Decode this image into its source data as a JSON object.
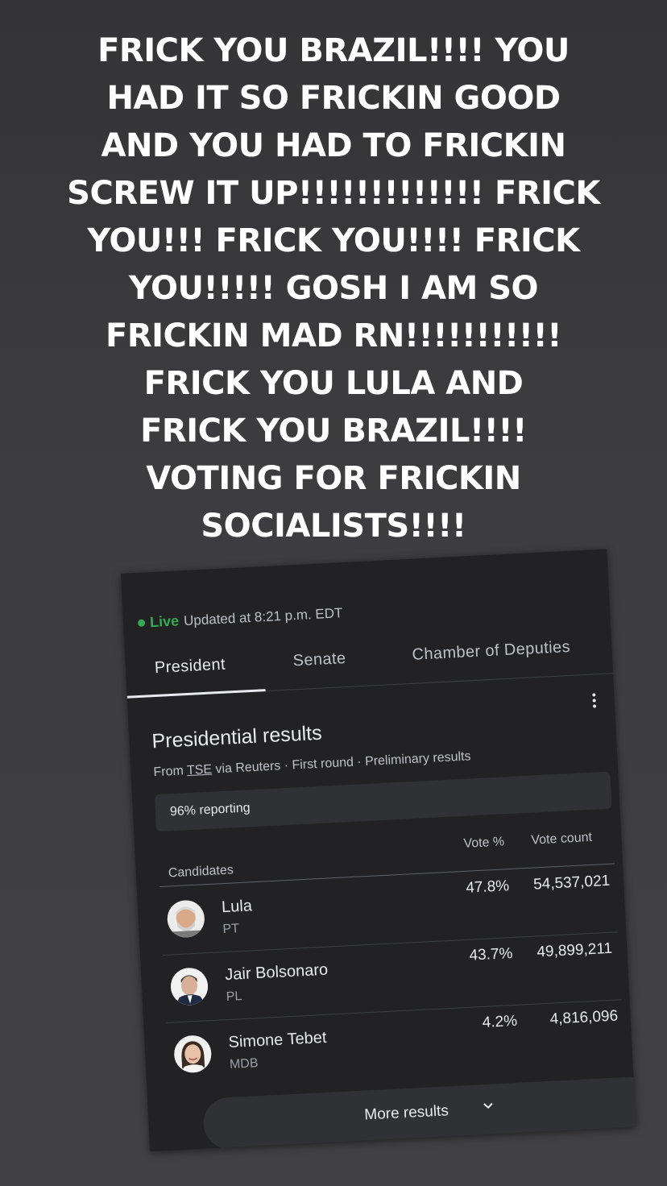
{
  "caption": {
    "lines": [
      "FRICK YOU BRAZIL!!!! YOU",
      "HAD IT SO FRICKIN GOOD",
      "AND YOU HAD TO FRICKIN",
      "SCREW IT UP!!!!!!!!!!!!! FRICK",
      "YOU!!! FRICK YOU!!!! FRICK",
      "YOU!!!!! GOSH I AM SO",
      "FRICKIN MAD RN!!!!!!!!!!!",
      "FRICK YOU LULA AND",
      "FRICK YOU BRAZIL!!!!",
      "VOTING FOR FRICKIN",
      "SOCIALISTS!!!!"
    ]
  },
  "status": {
    "live_label": "Live",
    "updated_text": "Updated at 8:21 p.m. EDT",
    "live_color": "#34a853"
  },
  "tabs": [
    {
      "label": "President",
      "active": true
    },
    {
      "label": "Senate",
      "active": false
    },
    {
      "label": "Chamber of Deputies",
      "active": false
    }
  ],
  "results": {
    "title": "Presidential results",
    "source_prefix": "From",
    "source_link": "TSE",
    "source_suffix": "via Reuters · First round · Preliminary results",
    "reporting": "96% reporting",
    "col_candidates": "Candidates",
    "col_vote_pct": "Vote %",
    "col_vote_count": "Vote count",
    "candidates": [
      {
        "name": "Lula",
        "party": "PT",
        "vote_pct": "47.8%",
        "vote_count": "54,537,021"
      },
      {
        "name": "Jair Bolsonaro",
        "party": "PL",
        "vote_pct": "43.7%",
        "vote_count": "49,899,211"
      },
      {
        "name": "Simone Tebet",
        "party": "MDB",
        "vote_pct": "4.2%",
        "vote_count": "4,816,096"
      }
    ],
    "more_label": "More results"
  },
  "icons": {
    "menu": "more-vert-icon",
    "expand": "chevron-down-icon",
    "live": "live-dot-icon"
  }
}
